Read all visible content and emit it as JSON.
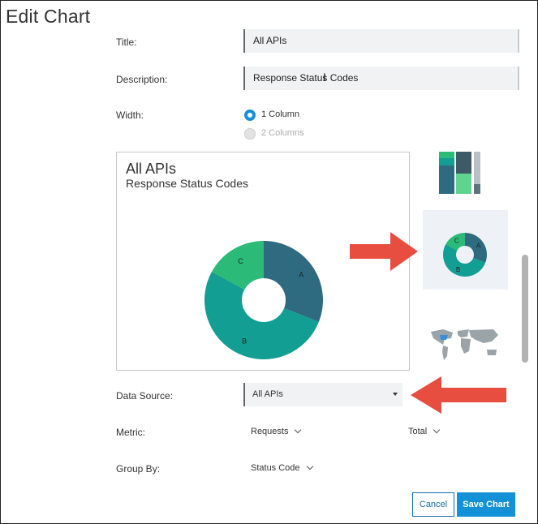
{
  "dialog": {
    "title": "Edit Chart"
  },
  "form": {
    "title_label": "Title:",
    "title_value": "All APIs",
    "description_label": "Description:",
    "description_value": "Response Status Codes",
    "width_label": "Width:",
    "width_options": [
      {
        "label": "1 Column",
        "selected": true
      },
      {
        "label": "2 Columns",
        "selected": false,
        "disabled": true
      }
    ],
    "data_source_label": "Data Source:",
    "data_source_value": "All APIs",
    "metric_label": "Metric:",
    "metric_value": "Requests",
    "aggregation_value": "Total",
    "group_by_label": "Group By:",
    "group_by_value": "Status Code"
  },
  "preview": {
    "title": "All APIs",
    "subtitle": "Response Status Codes"
  },
  "chart_data": {
    "type": "pie",
    "title": "All APIs",
    "subtitle": "Response Status Codes",
    "donut": true,
    "categories": [
      "A",
      "B",
      "C"
    ],
    "values": [
      31,
      52,
      17
    ],
    "colors": [
      "#2e6b80",
      "#129e92",
      "#2cba79"
    ]
  },
  "thumbnails": [
    {
      "kind": "stacked-bar",
      "selected": false
    },
    {
      "kind": "donut",
      "selected": true,
      "labels": [
        "C",
        "A",
        "B"
      ]
    },
    {
      "kind": "world-map",
      "selected": false
    }
  ],
  "buttons": {
    "cancel": "Cancel",
    "save": "Save Chart"
  },
  "colors": {
    "accent": "#1490d6",
    "arrow": "#e84e3f",
    "field_bg": "#f0f2f3"
  }
}
